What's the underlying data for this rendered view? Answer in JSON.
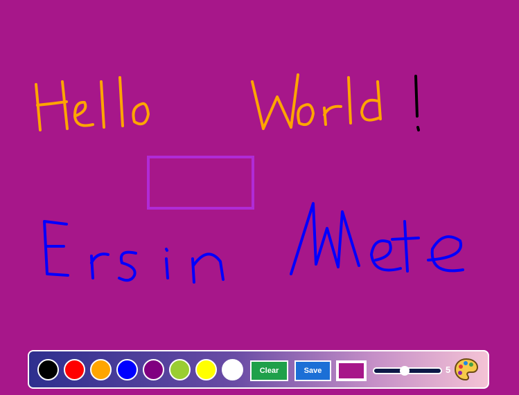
{
  "canvas": {
    "background": "#a7178a"
  },
  "drawing": {
    "colors": {
      "orange": "#ffa500",
      "black": "#000000",
      "purple_rect": "#b02bd6",
      "blue": "#0000ff"
    }
  },
  "toolbar": {
    "swatches": [
      {
        "name": "black",
        "color": "#000000"
      },
      {
        "name": "red",
        "color": "#ff0000"
      },
      {
        "name": "orange",
        "color": "#ffa500"
      },
      {
        "name": "blue",
        "color": "#0000ff"
      },
      {
        "name": "purple",
        "color": "#800080"
      },
      {
        "name": "green",
        "color": "#9acd32"
      },
      {
        "name": "yellow",
        "color": "#ffff00"
      },
      {
        "name": "white",
        "color": "#ffffff"
      }
    ],
    "clear_label": "Clear",
    "save_label": "Save",
    "current_color": "#a7178a",
    "brush_size": "5",
    "brush_fraction": 0.46,
    "palette_icon": "palette-icon"
  }
}
